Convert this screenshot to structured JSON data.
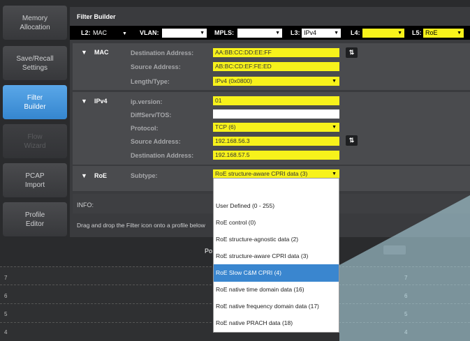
{
  "sidebar": [
    {
      "label": "Memory\nAllocation"
    },
    {
      "label": "Save/Recall\nSettings"
    },
    {
      "label": "Filter\nBuilder"
    },
    {
      "label": "Flow\nWizard"
    },
    {
      "label": "PCAP\nImport"
    },
    {
      "label": "Profile\nEditor"
    }
  ],
  "filter_builder": {
    "title": "Filter Builder",
    "layers": {
      "l2_label": "L2:",
      "l2_value": "MAC",
      "vlan_label": "VLAN:",
      "vlan_value": "",
      "mpls_label": "MPLS:",
      "mpls_value": "",
      "l3_label": "L3:",
      "l3_value": "IPv4",
      "l4_label": "L4:",
      "l4_value": "",
      "l5_label": "L5:",
      "l5_value": "RoE"
    },
    "mac": {
      "title": "MAC",
      "dest_label": "Destination Address:",
      "dest_value": "AA:BB:CC:DD:EE:FF",
      "src_label": "Source Address:",
      "src_value": "AB:BC:CD:EF:FE:ED",
      "lt_label": "Length/Type:",
      "lt_value": "IPv4 (0x0800)"
    },
    "ipv4": {
      "title": "IPv4",
      "ver_label": "ip.version:",
      "ver_value": "01",
      "diff_label": "DiffServ/TOS:",
      "diff_value": "",
      "proto_label": "Protocol:",
      "proto_value": "TCP (6)",
      "src_label": "Source Address:",
      "src_value": "192.168.56.3",
      "dest_label": "Destination Address:",
      "dest_value": "192.168.57.5"
    },
    "roe": {
      "title": "RoE",
      "subtype_label": "Subtype:",
      "subtype_value": "RoE structure-aware CPRI data (3)"
    },
    "info_label": "INFO:",
    "drag_text": "Drag and drop the Filter icon onto a profile below"
  },
  "dropdown": {
    "options": [
      "User Defined (0 - 255)",
      "RoE control (0)",
      "RoE structure-agnostic data (2)",
      "RoE structure-aware CPRI data (3)",
      "RoE Slow C&M CPRI (4)",
      "RoE native time domain data (16)",
      "RoE native frequency domain data (17)",
      "RoE native PRACH data (18)"
    ],
    "selected_index": 4
  },
  "lower": {
    "partial_text": "Po",
    "row_numbers": [
      "7",
      "6",
      "5",
      "4"
    ]
  },
  "colors": {
    "accent": "#3a86cf",
    "field": "#f7f21b"
  },
  "icons": {
    "swap": "swap-icon",
    "collapse": "triangle-down-icon",
    "dropdown": "chevron-down-icon"
  }
}
